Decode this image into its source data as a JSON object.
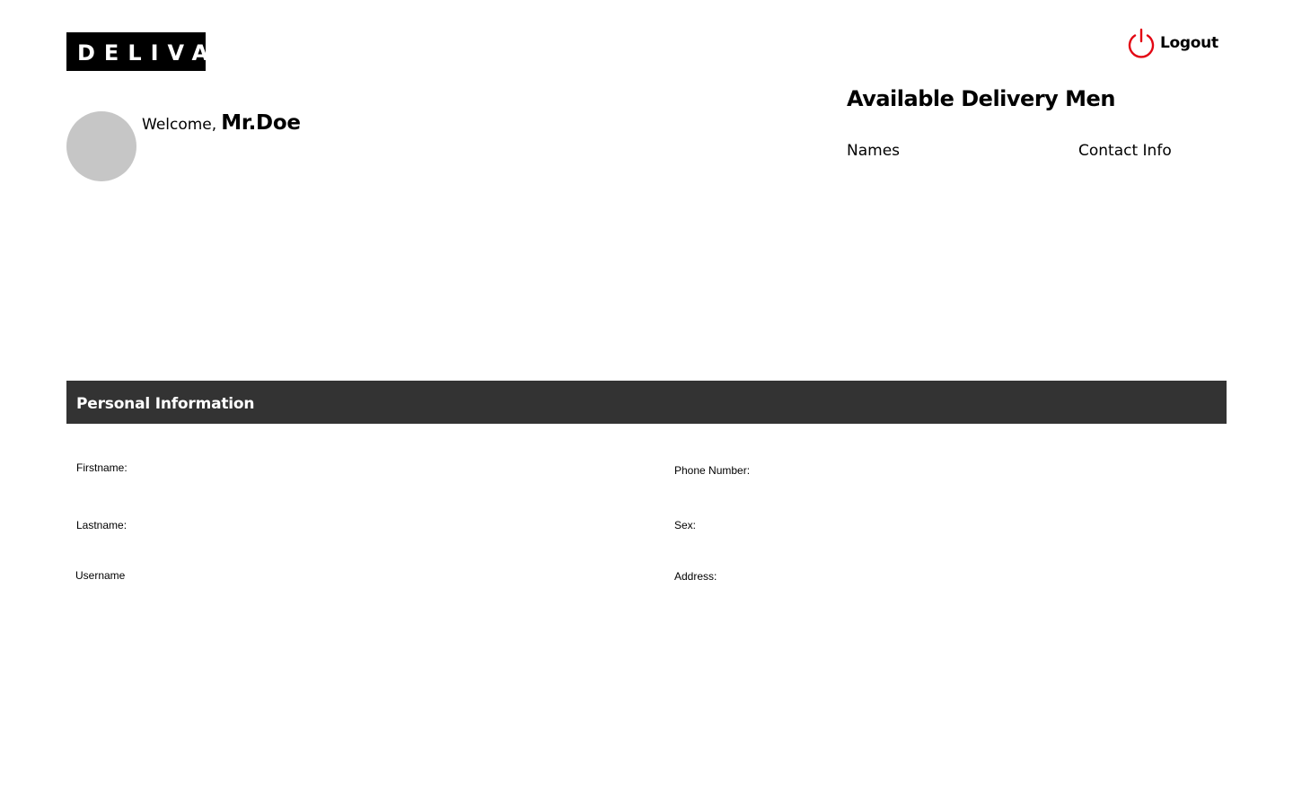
{
  "header": {
    "logo_text": "DELIVA",
    "logout_label": "Logout",
    "logout_icon": "power-icon",
    "logout_icon_color": "#e30613"
  },
  "user": {
    "welcome_text": "Welcome,",
    "name": "Mr.Doe"
  },
  "delivery_panel": {
    "title": "Available Delivery Men",
    "columns": [
      "Names",
      "Contact Info"
    ]
  },
  "personal_info": {
    "title": "Personal Information",
    "bar_color": "#333333",
    "fields_left": [
      "Firstname:",
      "Lastname:",
      "Username"
    ],
    "fields_right": [
      "Phone Number:",
      "Sex:",
      "Address:"
    ]
  }
}
